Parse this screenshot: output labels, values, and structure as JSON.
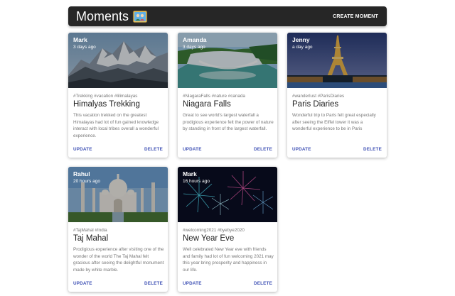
{
  "app": {
    "title": "Moments",
    "logo_icon": "photo-album-icon",
    "create_label": "CREATE MOMENT"
  },
  "posts": [
    {
      "author": "Mark",
      "time": "3 days ago",
      "tags": "#Trekking #vacation #lilimalayas",
      "title": "Himalyas Trekking",
      "message": "This vacation trekked on the greatest Himalayas had lot of fun gained knowledge interact with local tribes overall a wonderful experience.",
      "update_label": "UPDATE",
      "delete_label": "DELETE",
      "image": "mountain-photo"
    },
    {
      "author": "Amanda",
      "time": "3 days ago",
      "tags": "#NiagaraFalls #nature #canada",
      "title": "Niagara Falls",
      "message": "Great to see world's largest waterfall a prodigious experience felt the power of nature by standing in front of the largest waterfall.",
      "update_label": "UPDATE",
      "delete_label": "DELETE",
      "image": "waterfall-photo"
    },
    {
      "author": "Jenny",
      "time": "a day ago",
      "tags": "#wanderlust #ParisDiaries",
      "title": "Paris Diaries",
      "message": "Wonderful trip to Paris felt great especially after seeing the Eiffel tower it was a wonderful experience to be in Paris",
      "update_label": "UPDATE",
      "delete_label": "DELETE",
      "image": "eiffel-tower-photo"
    },
    {
      "author": "Rahul",
      "time": "20 hours ago",
      "tags": "#TajMahal #India",
      "title": "Taj Mahal",
      "message": "Prodigious experience after visiting one of the wonder of the world The Taj Mahal felt gracious after seeing the delightful monument made by white marble.",
      "update_label": "UPDATE",
      "delete_label": "DELETE",
      "image": "taj-mahal-photo"
    },
    {
      "author": "Mark",
      "time": "16 hours ago",
      "tags": "#welcoming2021 #byebye2020",
      "title": "New Year Eve",
      "message": "Well celebrated New Year eve with friends and family had lot of fun welcoming 2021 may this year bring prosperity and happiness in our life.",
      "update_label": "UPDATE",
      "delete_label": "DELETE",
      "image": "fireworks-photo"
    }
  ],
  "colors": {
    "appbar": "#262626",
    "accent": "#3f51b5"
  }
}
